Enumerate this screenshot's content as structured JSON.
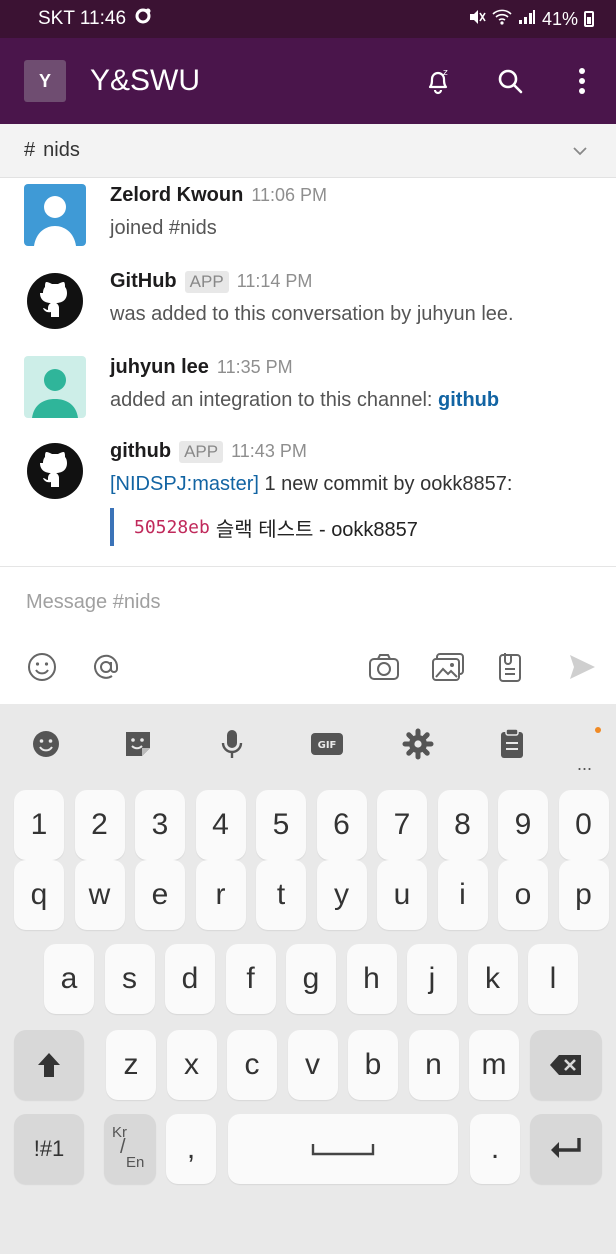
{
  "status_bar": {
    "carrier_time": "SKT 11:46",
    "battery": "41%"
  },
  "app_bar": {
    "workspace_initial": "Y",
    "workspace_name": "Y&SWU"
  },
  "channel_bar": {
    "hash": "#",
    "channel": "nids"
  },
  "messages": [
    {
      "name": "Zelord Kwoun",
      "time": "11:06 PM",
      "text": "joined #nids"
    },
    {
      "name": "GitHub",
      "badge": "APP",
      "time": "11:14 PM",
      "text": "was added to this conversation by juhyun lee."
    },
    {
      "name": "juhyun lee",
      "time": "11:35 PM",
      "text": "added an integration to this channel: ",
      "link": "github"
    },
    {
      "name": "github",
      "badge": "APP",
      "time": "11:43 PM",
      "ref": "[NIDSPJ:master]",
      "text": " 1 new commit by ookk8857:",
      "attachment": {
        "sha": "50528eb",
        "message": "슬랙 테스트 - ookk8857"
      }
    }
  ],
  "composer": {
    "placeholder": "Message #nids"
  },
  "keyboard": {
    "toolbar": {
      "gif": "GIF",
      "more": "···"
    },
    "row_numbers": [
      "1",
      "2",
      "3",
      "4",
      "5",
      "6",
      "7",
      "8",
      "9",
      "0"
    ],
    "row_1": [
      "q",
      "w",
      "e",
      "r",
      "t",
      "y",
      "u",
      "i",
      "o",
      "p"
    ],
    "row_2": [
      "a",
      "s",
      "d",
      "f",
      "g",
      "h",
      "j",
      "k",
      "l"
    ],
    "row_3": [
      "z",
      "x",
      "c",
      "v",
      "b",
      "n",
      "m"
    ],
    "symbols_key": "!#1",
    "lang_key_top": "Kr",
    "lang_key_bottom": "En",
    "comma_key": ",",
    "period_key": "."
  }
}
